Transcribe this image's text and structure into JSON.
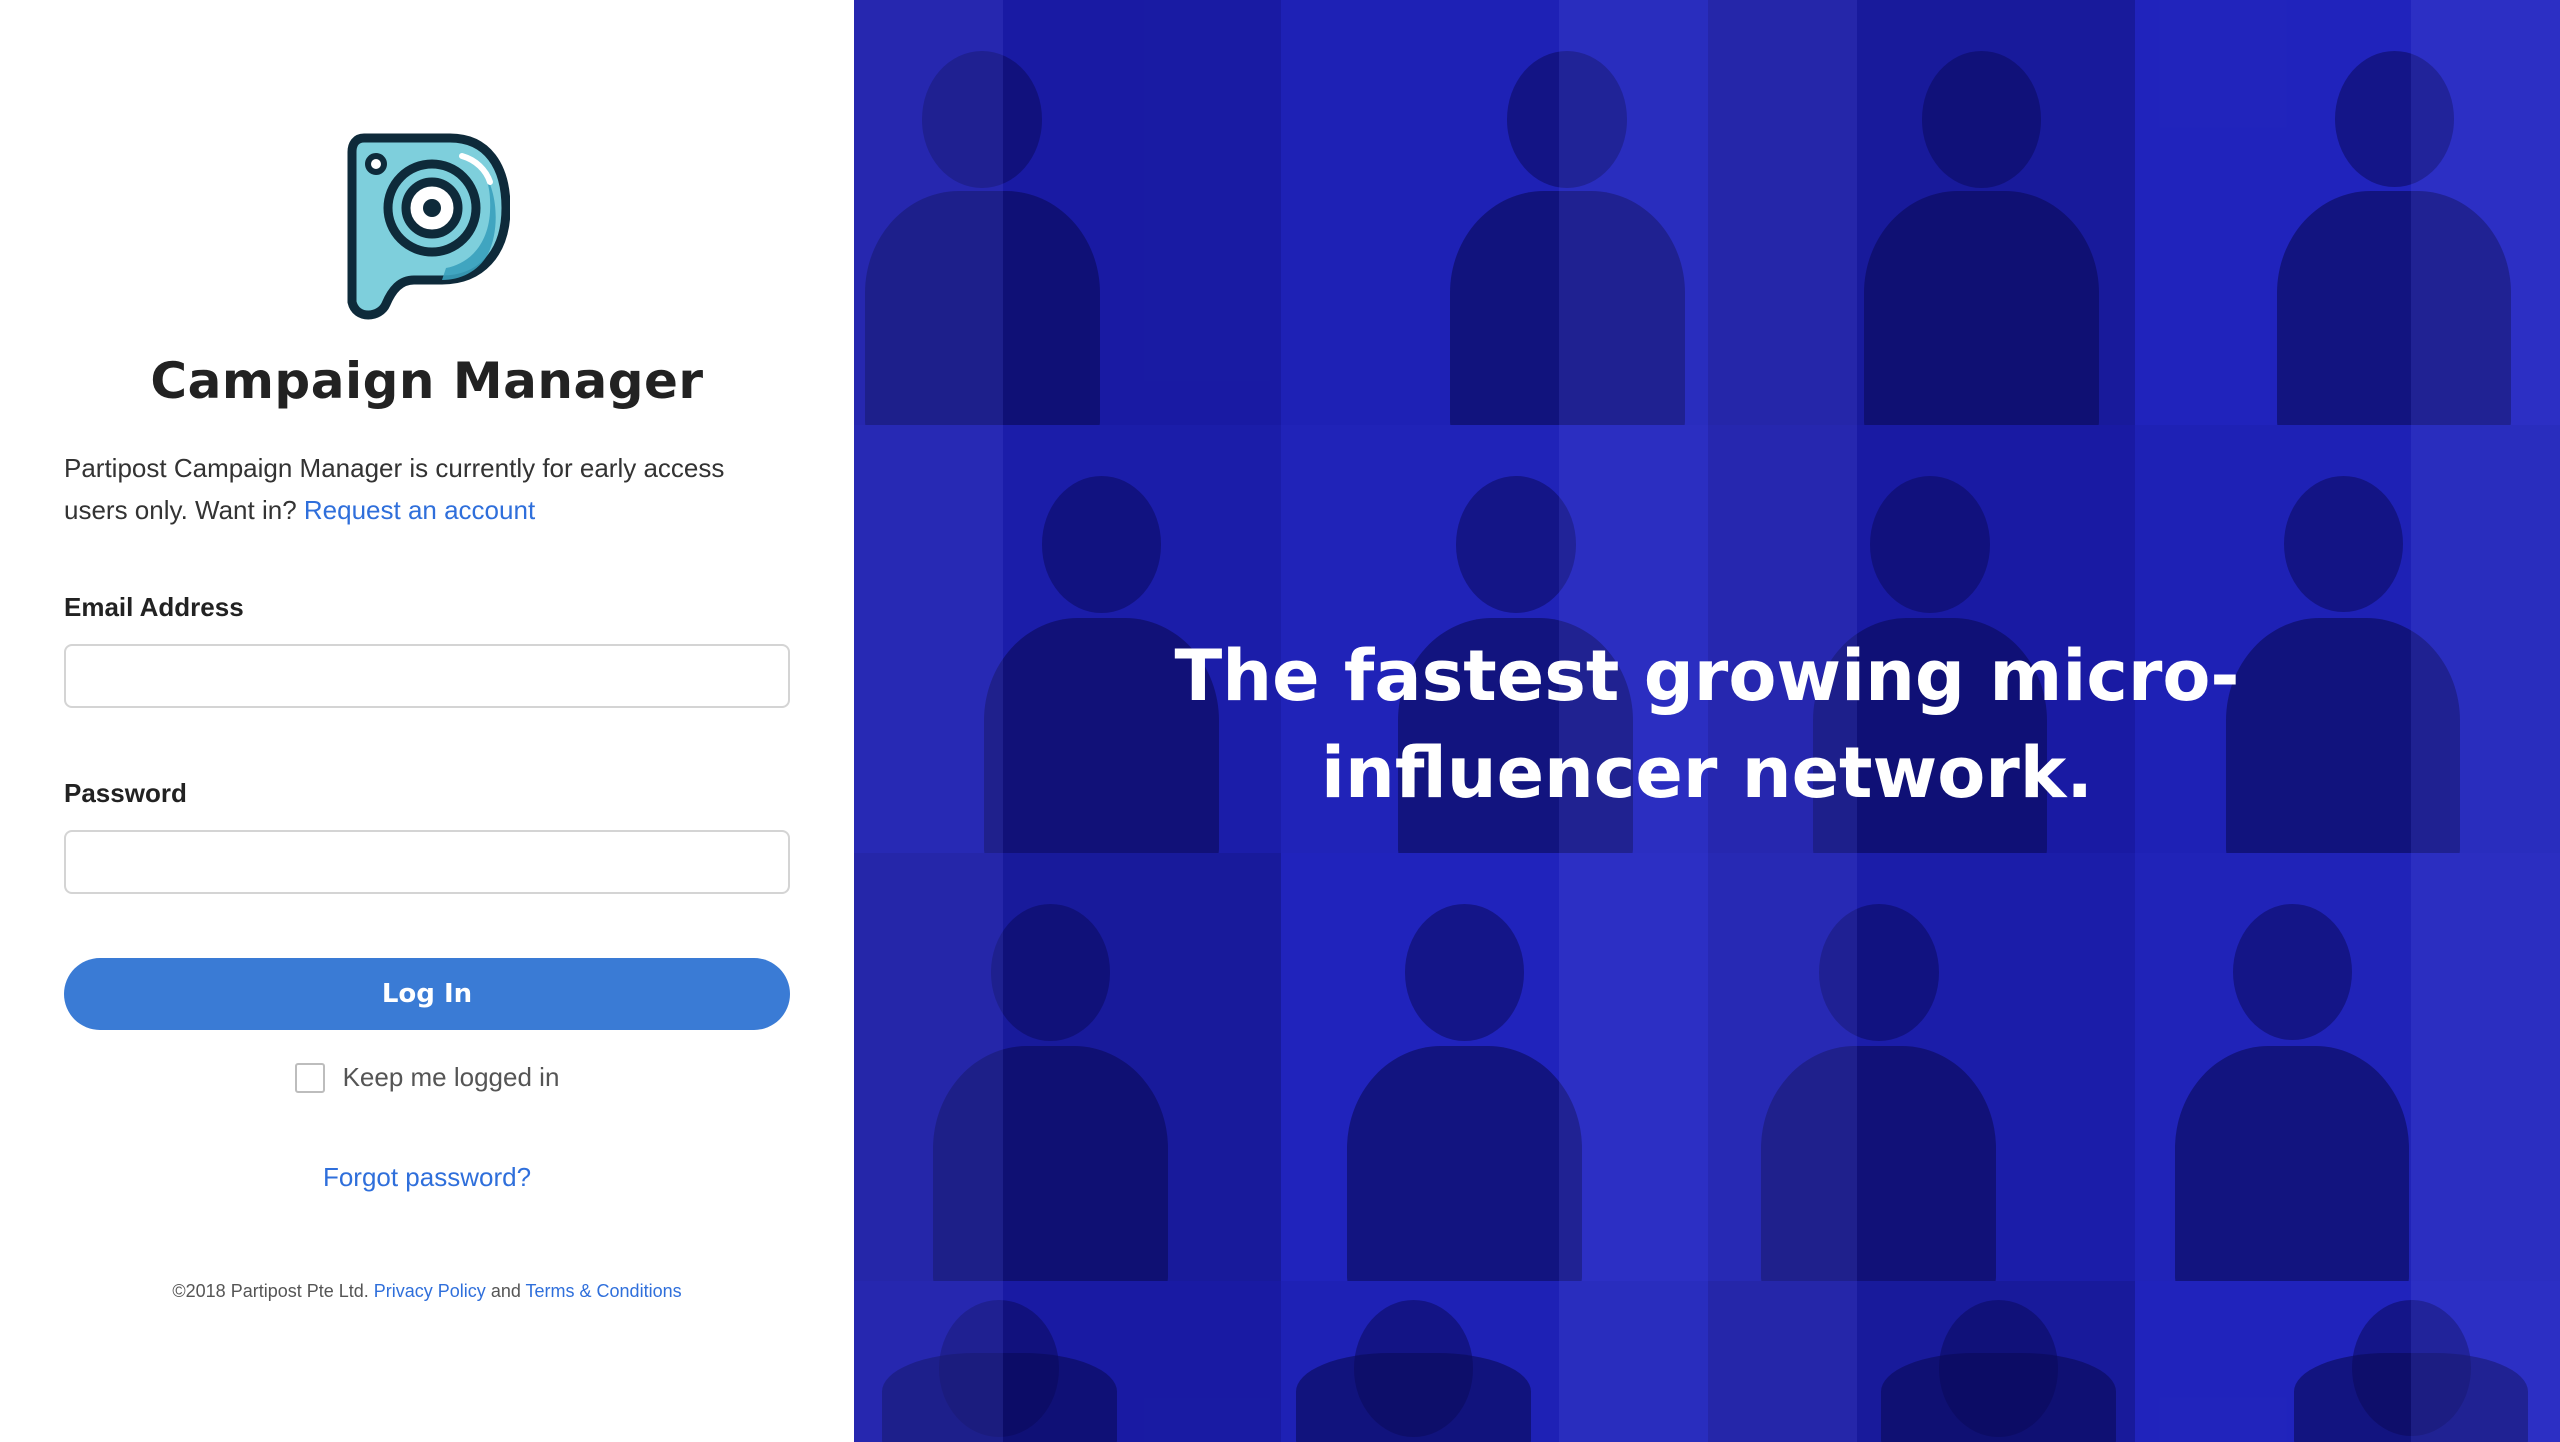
{
  "login": {
    "title": "Campaign Manager",
    "intro_text": "Partipost Campaign Manager is currently for early access users only. Want in? ",
    "request_link": "Request an account",
    "email_label": "Email Address",
    "email_value": "",
    "password_label": "Password",
    "password_value": "",
    "login_button": "Log In",
    "keep_logged_in": "Keep me logged in",
    "forgot_password": "Forgot password?"
  },
  "footer": {
    "copyright": "©2018 Partipost Pte Ltd. ",
    "privacy": "Privacy Policy",
    "and": " and ",
    "terms": "Terms & Conditions"
  },
  "hero": {
    "tagline": "The fastest growing micro-influencer network."
  },
  "icons": {
    "logo": "partipost-camera-p-logo",
    "checkbox": "checkbox-unchecked-icon"
  },
  "colors": {
    "accent": "#3a7bd5",
    "link": "#2f6fdb",
    "hero_tint": "#1c1fa6",
    "logo_teal": "#7ecfdc",
    "logo_outline": "#0e2a3a"
  }
}
